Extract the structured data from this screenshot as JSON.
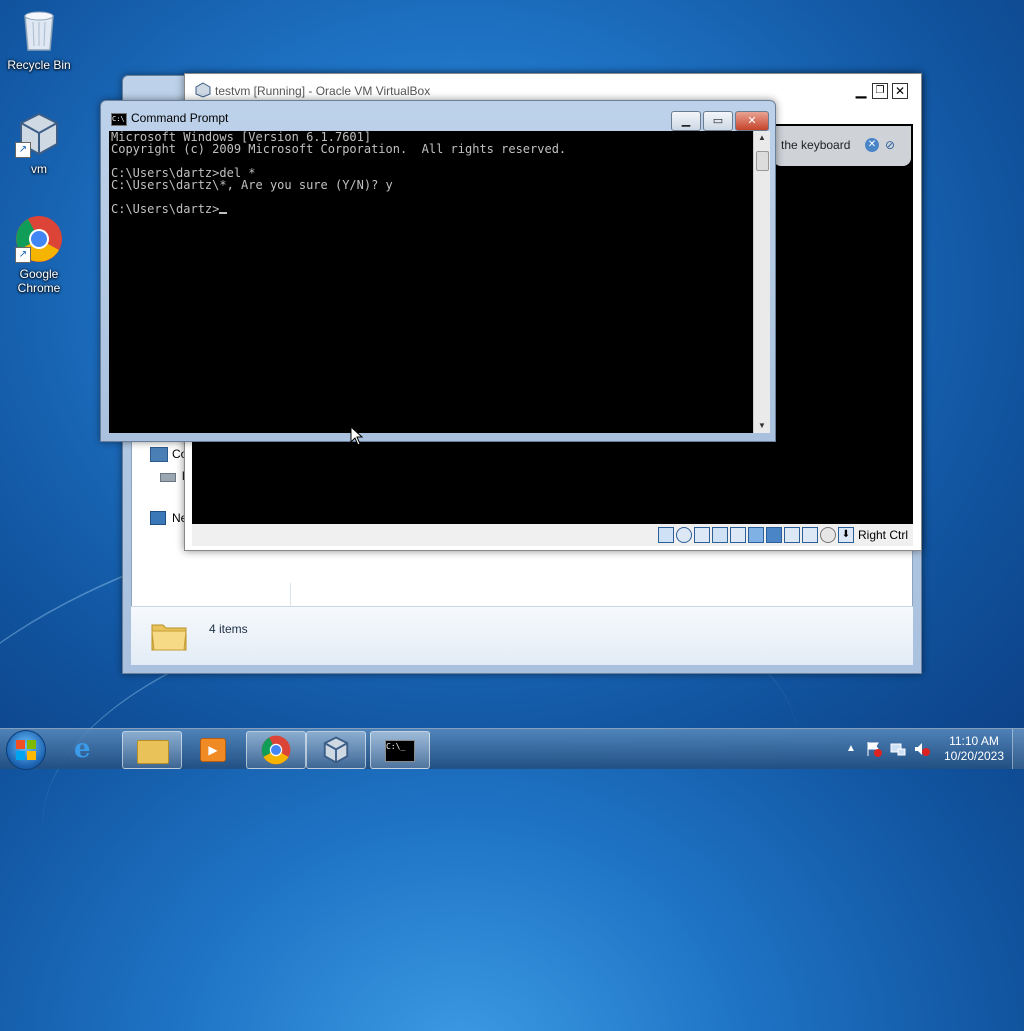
{
  "desktop": {
    "icons": [
      {
        "label": "Recycle Bin"
      },
      {
        "label": "vm"
      },
      {
        "label": "Google Chrome"
      }
    ]
  },
  "explorer": {
    "nav_items": [
      "Co",
      "l",
      "Ne"
    ],
    "status_items": "4 items"
  },
  "virtualbox": {
    "title": "testvm [Running] - Oracle VM VirtualBox",
    "notice_text": "the keyboard",
    "host_key": "Right Ctrl"
  },
  "cmd": {
    "title": "Command Prompt",
    "lines": [
      "Microsoft Windows [Version 6.1.7601]",
      "Copyright (c) 2009 Microsoft Corporation.  All rights reserved.",
      "",
      "C:\\Users\\dartz>del *",
      "C:\\Users\\dartz\\*, Are you sure (Y/N)? y",
      "",
      "C:\\Users\\dartz>"
    ]
  },
  "taskbar": {
    "time": "11:10 AM",
    "date": "10/20/2023"
  },
  "colors": {
    "console_bg": "#000000",
    "console_fg": "#c0c0c0",
    "taskbar": "#23507f"
  }
}
